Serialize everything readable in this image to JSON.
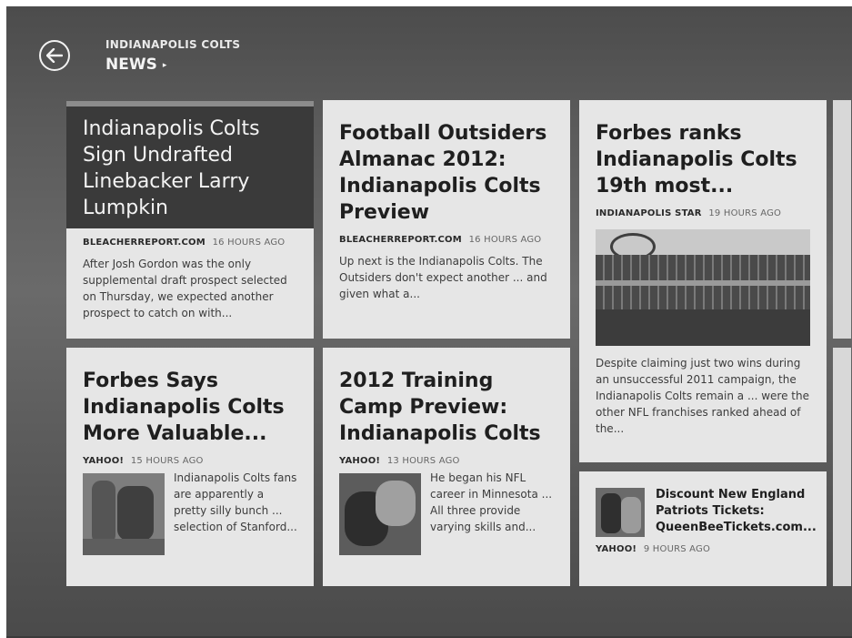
{
  "header": {
    "app_title": "INDIANAPOLIS COLTS",
    "section_title": "NEWS",
    "section_chevron": "▸",
    "back_icon": "back-arrow-icon"
  },
  "articles": [
    {
      "headline": "Indianapolis Colts Sign Undrafted Linebacker Larry Lumpkin",
      "source": "BLEACHERREPORT.COM",
      "time": "16 HOURS AGO",
      "summary": "After Josh Gordon was the only supplemental draft prospect selected on Thursday, we expected another prospect to catch on with..."
    },
    {
      "headline": "Football Outsiders Almanac 2012: Indianapolis Colts Preview",
      "source": "BLEACHERREPORT.COM",
      "time": "16 HOURS AGO",
      "summary": "Up next is the Indianapolis Colts. The Outsiders don't expect another ... and given what a..."
    },
    {
      "headline": "Forbes ranks Indianapolis Colts 19th most...",
      "source": "INDIANAPOLIS STAR",
      "time": "19 HOURS AGO",
      "summary": "Despite claiming just two wins during an unsuccessful 2011 campaign, the Indianapolis Colts remain a ... were the other NFL franchises ranked ahead of the..."
    },
    {
      "headline": "Forbes Says Indianapolis Colts More Valuable...",
      "source": "YAHOO!",
      "time": "15 HOURS AGO",
      "summary": "Indianapolis Colts fans are apparently a pretty silly bunch ... selection of Stanford..."
    },
    {
      "headline": "2012 Training Camp Preview: Indianapolis Colts",
      "source": "YAHOO!",
      "time": "13 HOURS AGO",
      "summary": "He began his NFL career in Minnesota ... All three provide varying skills and..."
    },
    {
      "headline": "Discount New England Patriots Tickets: QueenBeeTickets.com...",
      "source": "YAHOO!",
      "time": "9 HOURS AGO"
    }
  ]
}
